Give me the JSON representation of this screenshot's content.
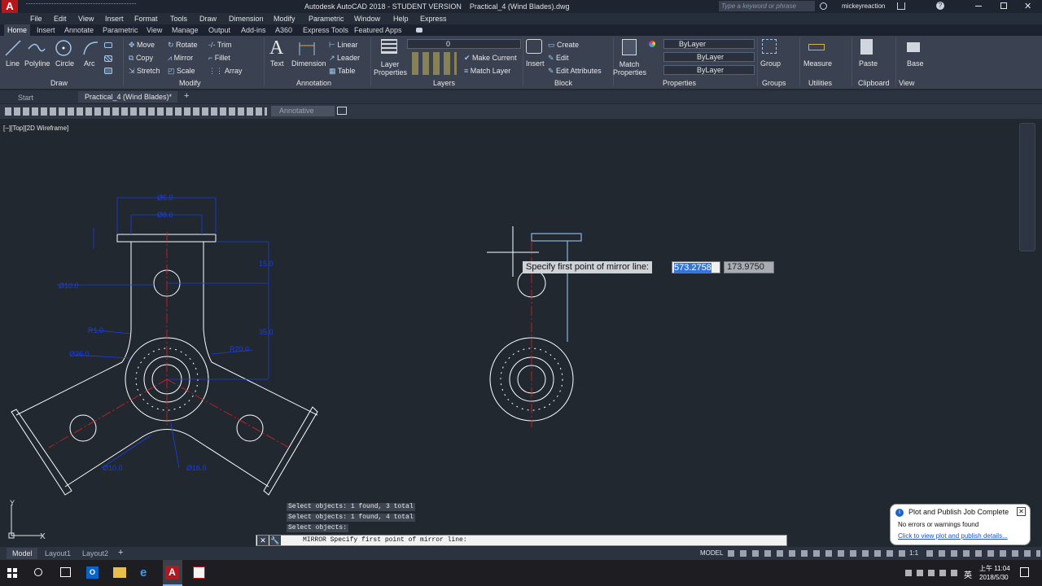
{
  "app": {
    "title": "Autodesk AutoCAD 2018 - STUDENT VERSION    Practical_4 (Wind Blades).dwg",
    "search_placeholder": "Type a keyword or phrase",
    "user": "mickeyreaction"
  },
  "menu": [
    "File",
    "Edit",
    "View",
    "Insert",
    "Format",
    "Tools",
    "Draw",
    "Dimension",
    "Modify",
    "Parametric",
    "Window",
    "Help",
    "Express"
  ],
  "ribbon_tabs": [
    "Home",
    "Insert",
    "Annotate",
    "Parametric",
    "View",
    "Manage",
    "Output",
    "Add-ins",
    "A360",
    "Express Tools",
    "Featured Apps"
  ],
  "draw": {
    "line": "Line",
    "polyline": "Polyline",
    "circle": "Circle",
    "arc": "Arc",
    "panel": "Draw"
  },
  "modify": {
    "move": "Move",
    "rotate": "Rotate",
    "trim": "Trim",
    "copy": "Copy",
    "mirror": "Mirror",
    "fillet": "Fillet",
    "stretch": "Stretch",
    "scale": "Scale",
    "array": "Array",
    "panel": "Modify"
  },
  "annotation": {
    "text": "Text",
    "dimension": "Dimension",
    "linear": "Linear",
    "leader": "Leader",
    "table": "Table",
    "panel": "Annotation"
  },
  "layers": {
    "layer_properties": "Layer Properties",
    "current_layer": "0",
    "make_current": "Make Current",
    "match_layer": "Match Layer",
    "panel": "Layers"
  },
  "block": {
    "insert": "Insert",
    "create": "Create",
    "edit": "Edit",
    "edit_attributes": "Edit Attributes",
    "panel": "Block"
  },
  "properties": {
    "match_properties": "Match Properties",
    "color": "ByLayer",
    "linetype": "ByLayer",
    "lineweight": "ByLayer",
    "panel": "Properties"
  },
  "groups": {
    "group": "Group",
    "panel": "Groups"
  },
  "utilities": {
    "measure": "Measure",
    "panel": "Utilities"
  },
  "clipboard": {
    "paste": "Paste",
    "panel": "Clipboard"
  },
  "view_panel": {
    "base": "Base",
    "panel": "View"
  },
  "doc_tabs": {
    "start": "Start",
    "active": "Practical_4 (Wind Blades)*"
  },
  "toolbar": {
    "annotative": "Annotative"
  },
  "viewport_label": "[−][Top][2D Wireframe]",
  "dims": {
    "d1": "Ø5.0",
    "d2": "Ø8.0",
    "d3": "15.0",
    "d4": "35.0",
    "d5": "Ø10.0",
    "d6": "R1.0",
    "d7": "Ø36.0",
    "d8": "R20.0",
    "d9": "Ø10.0",
    "d10": "Ø16.0"
  },
  "mirror_prompt": {
    "label": "Specify first point of mirror line:",
    "x": "573.2758",
    "y": "173.9750"
  },
  "history": [
    "Select objects: 1 found, 3 total",
    "Select objects: 1 found, 4 total",
    "Select objects:"
  ],
  "command": {
    "text": "MIRROR Specify first point of mirror line:"
  },
  "layout_tabs": [
    "Model",
    "Layout1",
    "Layout2"
  ],
  "status": {
    "model": "MODEL",
    "scale": "1:1"
  },
  "notification": {
    "title": "Plot and Publish Job Complete",
    "message": "No errors or warnings found",
    "link": "Click to view plot and publish details..."
  },
  "clock": {
    "time": "上午 11:04",
    "date": "2018/5/30",
    "ime": "英"
  }
}
